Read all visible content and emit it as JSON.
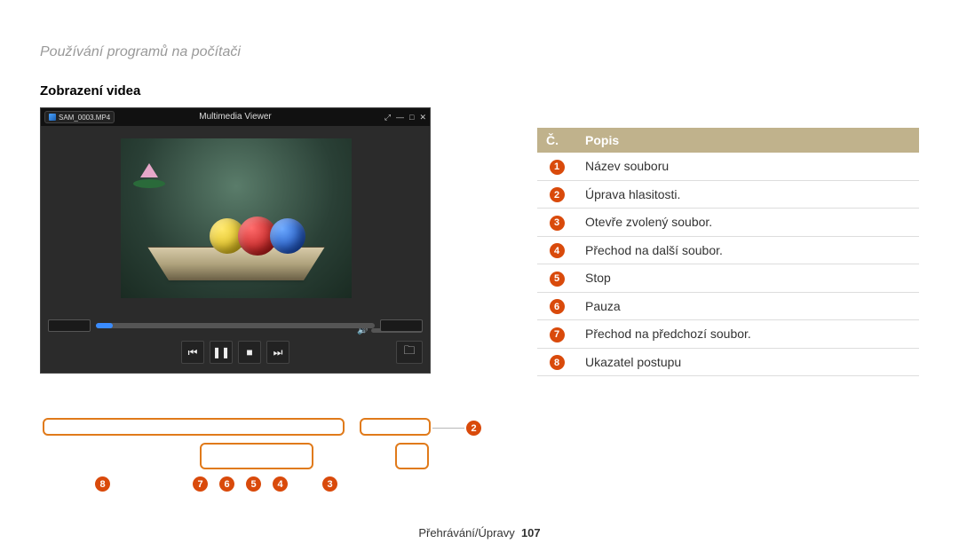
{
  "chapter_title": "Používání programů na počítači",
  "section_title": "Zobrazení videa",
  "viewer": {
    "file_name": "SAM_0003.MP4",
    "window_title": "Multimedia Viewer"
  },
  "table": {
    "header_num": "Č.",
    "header_desc": "Popis",
    "rows": [
      "Název souboru",
      "Úprava hlasitosti.",
      "Otevře zvolený soubor.",
      "Přechod na další soubor.",
      "Stop",
      "Pauza",
      "Přechod na předchozí soubor.",
      "Ukazatel postupu"
    ]
  },
  "callouts": [
    "1",
    "2",
    "3",
    "4",
    "5",
    "6",
    "7",
    "8"
  ],
  "footer": {
    "section": "Přehrávání/Úpravy",
    "page": "107"
  }
}
